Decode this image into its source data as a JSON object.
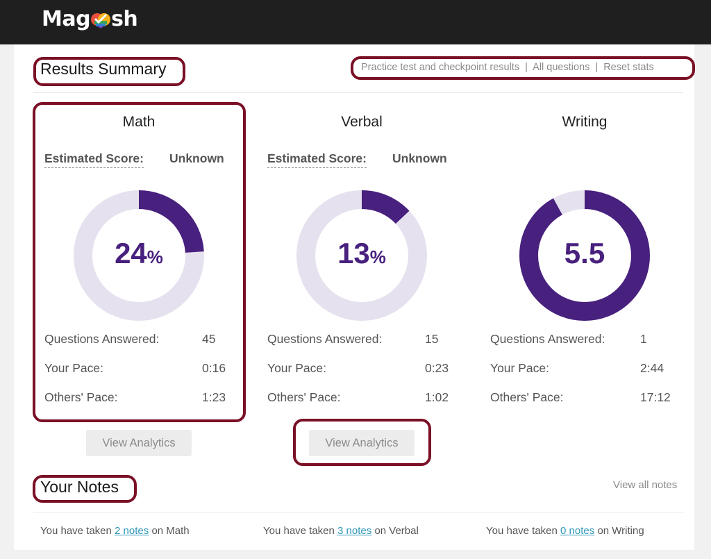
{
  "header": {
    "logo_text_left": "Mag",
    "logo_text_right": "sh"
  },
  "results": {
    "title": "Results Summary",
    "links": [
      "Practice test and checkpoint results",
      "All questions",
      "Reset stats"
    ],
    "link_separator": "|"
  },
  "sections": [
    {
      "title": "Math",
      "estimated_label": "Estimated Score:",
      "estimated_value": "Unknown",
      "donut_value": "24",
      "donut_unit": "%",
      "fill_fraction": 0.24,
      "stats": [
        {
          "label": "Questions Answered:",
          "value": "45"
        },
        {
          "label": "Your Pace:",
          "value": "0:16"
        },
        {
          "label": "Others' Pace:",
          "value": "1:23"
        }
      ],
      "button": "View Analytics"
    },
    {
      "title": "Verbal",
      "estimated_label": "Estimated Score:",
      "estimated_value": "Unknown",
      "donut_value": "13",
      "donut_unit": "%",
      "fill_fraction": 0.13,
      "stats": [
        {
          "label": "Questions Answered:",
          "value": "15"
        },
        {
          "label": "Your Pace:",
          "value": "0:23"
        },
        {
          "label": "Others' Pace:",
          "value": "1:02"
        }
      ],
      "button": "View Analytics"
    },
    {
      "title": "Writing",
      "donut_value": "5.5",
      "fill_fraction": 0.92,
      "stats": [
        {
          "label": "Questions Answered:",
          "value": "1"
        },
        {
          "label": "Your Pace:",
          "value": "2:44"
        },
        {
          "label": "Others' Pace:",
          "value": "17:12"
        }
      ]
    }
  ],
  "notes": {
    "title": "Your Notes",
    "view_all": "View all notes",
    "items": [
      {
        "prefix": "You have taken",
        "link": "2 notes",
        "suffix": "on Math"
      },
      {
        "prefix": "You have taken",
        "link": "3 notes",
        "suffix": "on Verbal"
      },
      {
        "prefix": "You have taken",
        "link": "0 notes",
        "suffix": "on Writing"
      }
    ]
  },
  "colors": {
    "accent": "#48207e",
    "track": "#e6e1ee",
    "highlight": "#7a1026",
    "link": "#2f97b8"
  }
}
